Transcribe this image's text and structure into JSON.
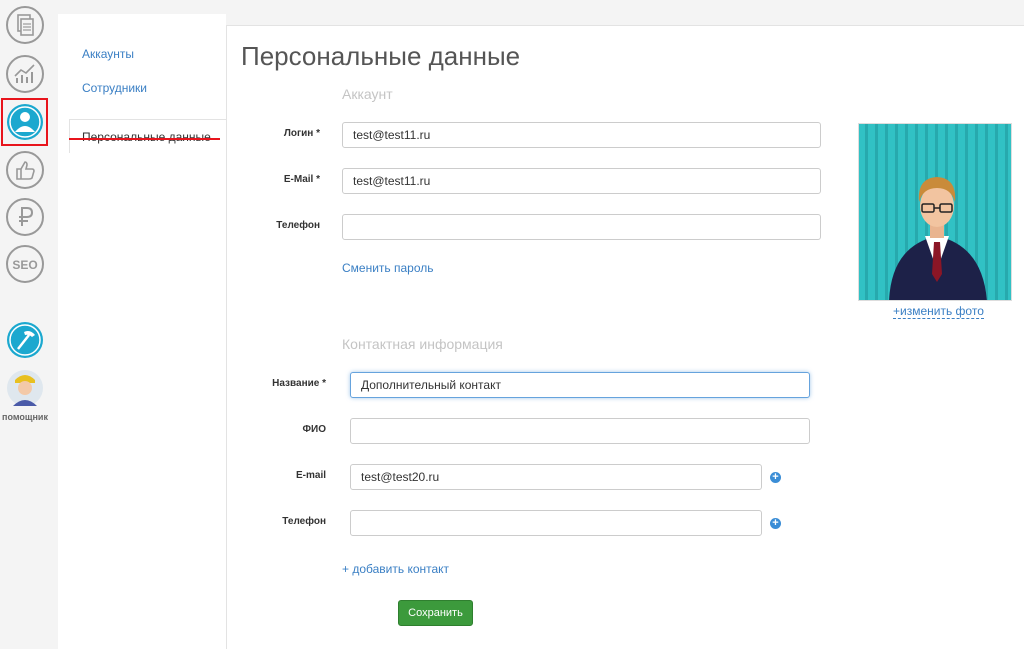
{
  "rail": {
    "icons": [
      "documents-icon",
      "analytics-icon",
      "user-profile-icon",
      "thumbs-up-icon",
      "ruble-icon",
      "seo-icon",
      "hammer-icon"
    ],
    "helper_label": "помощник",
    "active_color": "#e8141c",
    "accent_color": "#1ba8cf"
  },
  "subnav": {
    "items": [
      "Аккаунты",
      "Сотрудники",
      "Персональные данные"
    ]
  },
  "page": {
    "title": "Персональные данные"
  },
  "account": {
    "section_title": "Аккаунт",
    "login_label": "Логин *",
    "login_value": "test@test11.ru",
    "email_label": "E-Mail *",
    "email_value": "test@test11.ru",
    "phone_label": "Телефон",
    "phone_value": "",
    "change_password": "Сменить пароль"
  },
  "photo": {
    "change_link": "+изменить фото"
  },
  "contact": {
    "section_title": "Контактная информация",
    "name_label": "Название *",
    "name_value": "Дополнительный контакт",
    "fio_label": "ФИО",
    "fio_value": "",
    "email_label": "E-mail",
    "email_value": "test@test20.ru",
    "phone_label": "Телефон",
    "phone_value": "",
    "add_contact": "+ добавить контакт"
  },
  "actions": {
    "save": "Сохранить"
  },
  "colors": {
    "link": "#3a7fc4",
    "save_button": "#3c9a3c"
  }
}
